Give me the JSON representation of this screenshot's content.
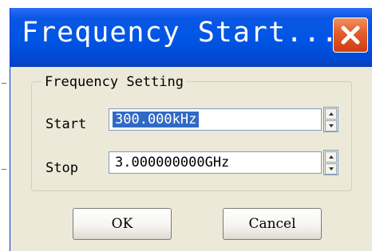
{
  "dialog": {
    "title": "Frequency Start...",
    "group_label": "Frequency Setting",
    "start_label": "Start",
    "start_value": "300.000kHz",
    "stop_label": "Stop",
    "stop_value": "3.000000000GHz",
    "ok_label": "OK",
    "cancel_label": "Cancel"
  },
  "colors": {
    "titlebar": "#0055e5",
    "close_button": "#e25c2a",
    "dialog_face": "#ece9d8",
    "selection": "#316ac5"
  },
  "icons": [
    "close-icon",
    "spin-up-icon",
    "spin-down-icon"
  ]
}
